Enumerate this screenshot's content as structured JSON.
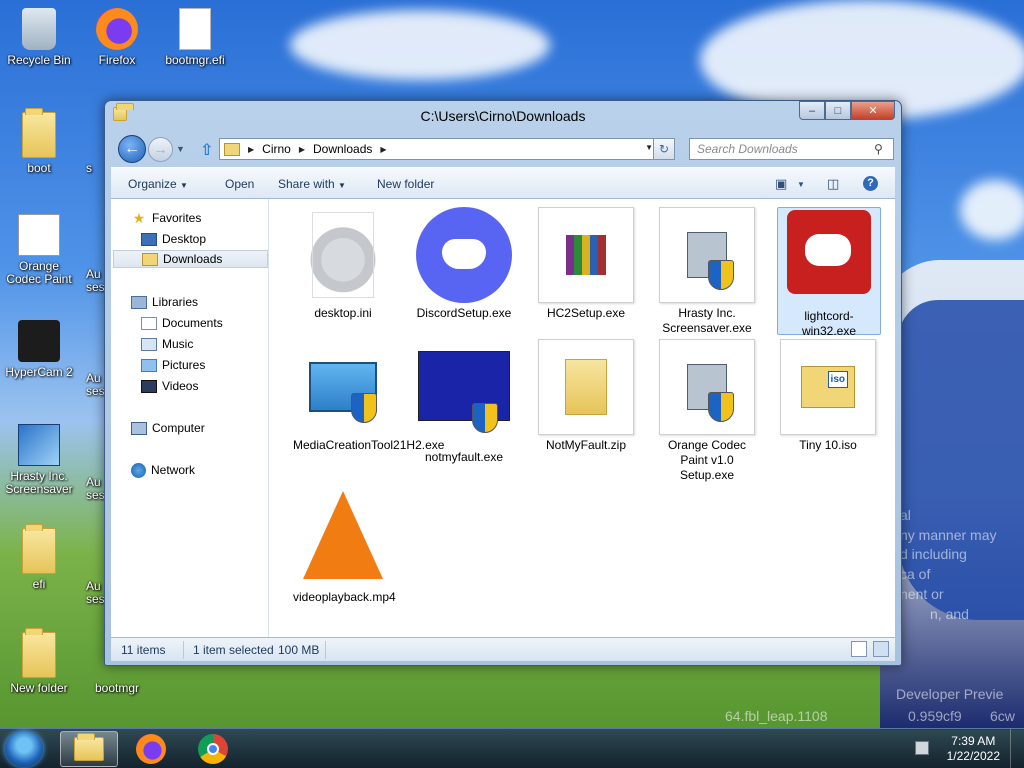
{
  "desktop": {
    "icons": [
      {
        "label": "Recycle Bin",
        "icon": "recycle-bin-icon"
      },
      {
        "label": "Firefox",
        "icon": "firefox-icon"
      },
      {
        "label": "bootmgr.efi",
        "icon": "file-icon"
      },
      {
        "label": "boot",
        "icon": "folder-icon"
      },
      {
        "label": "Orange Codec Paint",
        "icon": "paint-icon"
      },
      {
        "label": "HyperCam 2",
        "icon": "hypercam-icon"
      },
      {
        "label": "Hrasty Inc. Screensaver",
        "icon": "screensaver-icon"
      },
      {
        "label": "efi",
        "icon": "folder-icon"
      },
      {
        "label": "New folder",
        "icon": "folder-icon"
      },
      {
        "label": "bootmgr",
        "icon": "file-icon"
      }
    ],
    "partial_labels": [
      "s",
      "Au",
      "sess",
      "Au",
      "sess",
      "Au",
      "sess",
      "Au",
      "sess"
    ],
    "wallpaper_text": [
      "al",
      "ny manner may",
      "d including",
      "ca of",
      "nent or",
      "n, and",
      "Developer Previe",
      "64.fbl_leap.1108",
      "0.959cf9",
      "6cw"
    ]
  },
  "window": {
    "title": "C:\\Users\\Cirno\\Downloads",
    "caption": {
      "minimize": "–",
      "maximize": "□",
      "close": "✕"
    },
    "address": {
      "crumbs": [
        "Cirno",
        "Downloads"
      ]
    },
    "search": {
      "placeholder": "Search Downloads"
    },
    "toolbar": {
      "organize": "Organize",
      "open": "Open",
      "share_with": "Share with",
      "new_folder": "New folder"
    },
    "nav": {
      "favorites": "Favorites",
      "desktop": "Desktop",
      "downloads": "Downloads",
      "libraries": "Libraries",
      "documents": "Documents",
      "music": "Music",
      "pictures": "Pictures",
      "videos": "Videos",
      "computer": "Computer",
      "network": "Network"
    },
    "files": [
      {
        "name": "desktop.ini",
        "kind": "settings-file"
      },
      {
        "name": "DiscordSetup.exe",
        "kind": "discord"
      },
      {
        "name": "HC2Setup.exe",
        "kind": "winrar-installer"
      },
      {
        "name": "Hrasty Inc. Screensaver.exe",
        "kind": "installer"
      },
      {
        "name": "lightcord-win32.exe",
        "kind": "lightcord",
        "selected": true
      },
      {
        "name": "MediaCreationTool21H2.exe",
        "kind": "media-creation"
      },
      {
        "name": "notmyfault.exe",
        "kind": "notmyfault"
      },
      {
        "name": "NotMyFault.zip",
        "kind": "zip"
      },
      {
        "name": "Orange Codec Paint v1.0 Setup.exe",
        "kind": "installer"
      },
      {
        "name": "Tiny 10.iso",
        "kind": "iso"
      },
      {
        "name": "videoplayback.mp4",
        "kind": "vlc-video"
      }
    ],
    "status": {
      "count": "11 items",
      "selection": "1 item selected",
      "size": "100 MB"
    }
  },
  "taskbar": {
    "time": "7:39 AM",
    "date": "1/22/2022"
  },
  "colors": {
    "selection": "#d6e8fc",
    "accent_blue": "#1f5fb6",
    "discord": "#5865f2",
    "lightcord": "#c8201f"
  }
}
